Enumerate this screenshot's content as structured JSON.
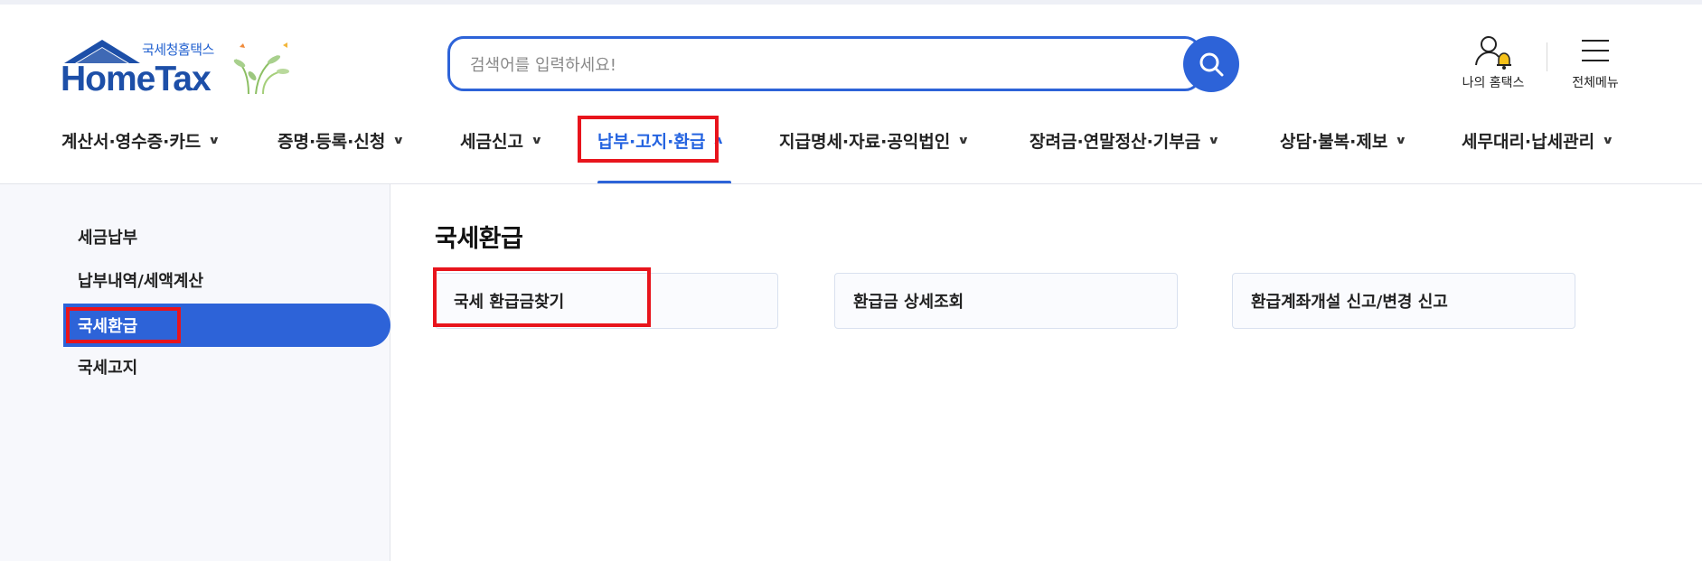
{
  "header": {
    "logo_kor": "국세청홈택스",
    "logo_en": "HomeTax",
    "search_placeholder": "검색어를 입력하세요!",
    "my_hometax_label": "나의 홈택스",
    "all_menu_label": "전체메뉴"
  },
  "gnb": {
    "items": [
      {
        "label": "계산서·영수증·카드"
      },
      {
        "label": "증명·등록·신청"
      },
      {
        "label": "세금신고"
      },
      {
        "label": "납부·고지·환급",
        "active": true
      },
      {
        "label": "지급명세·자료·공익법인"
      },
      {
        "label": "장려금·연말정산·기부금"
      },
      {
        "label": "상담·불복·제보"
      },
      {
        "label": "세무대리·납세관리"
      }
    ]
  },
  "sidebar": {
    "items": [
      {
        "label": "세금납부"
      },
      {
        "label": "납부내역/세액계산"
      },
      {
        "label": "국세환급",
        "active": true
      },
      {
        "label": "국세고지"
      }
    ]
  },
  "main": {
    "title": "국세환급",
    "cards": [
      {
        "label": "국세 환급금찾기"
      },
      {
        "label": "환급금 상세조회"
      },
      {
        "label": "환급계좌개설 신고/변경 신고"
      }
    ]
  },
  "colors": {
    "accent": "#2d63d8",
    "highlight_box": "#e8141c",
    "sidebar_bg": "#f7f8fc"
  },
  "icons": {
    "search": "search-icon",
    "user": "user-bell-icon",
    "menu": "hamburger-icon"
  }
}
